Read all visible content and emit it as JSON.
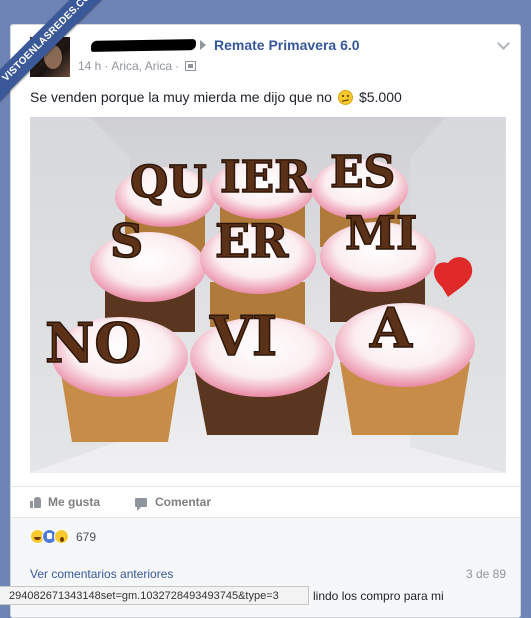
{
  "watermark": {
    "text": "VISTOENLASREDES.COM"
  },
  "post": {
    "group_name": "Remate Primavera 6.0",
    "time": "14 h",
    "location": "Arica, Arica",
    "text": "Se venden porque la muy mierda me dijo que no",
    "emoji": "confused-face",
    "price": "$5.000",
    "photo_letters": [
      "QU",
      "IER",
      "ES",
      "S",
      "ER",
      "MI",
      "NO",
      "VI",
      "A"
    ]
  },
  "actions": {
    "like": "Me gusta",
    "comment": "Comentar"
  },
  "reactions": {
    "count": "679"
  },
  "comments": {
    "prev_label": "Ver comentarios anteriores",
    "count": "3 de 89",
    "url_tooltip": "294082671343148set=gm.1032728493493745&type=3",
    "snippet": "lindo los compro para mi"
  },
  "colors": {
    "link": "#365899",
    "background": "#6d84b4",
    "ribbon": "#3b5998"
  }
}
